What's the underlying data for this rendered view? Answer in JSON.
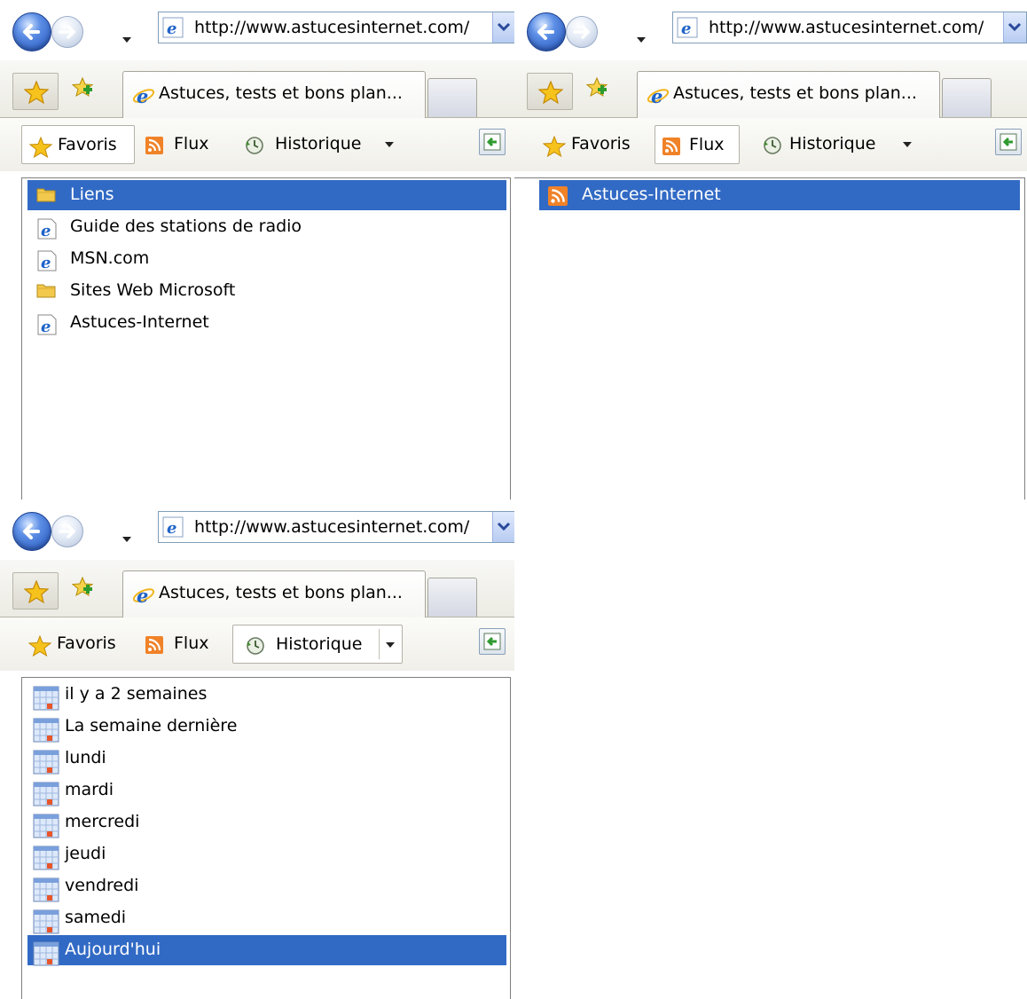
{
  "browser": {
    "address_url": "http://www.astucesinternet.com/",
    "tab_title": "Astuces, tests et bons plan..."
  },
  "center": {
    "favorites_label": "Favoris",
    "feeds_label": "Flux",
    "history_label": "Historique"
  },
  "panels": [
    {
      "active_tab": "Favoris",
      "items": [
        {
          "icon": "folder-icon",
          "label": "Liens",
          "selected": true
        },
        {
          "icon": "ie-page-icon",
          "label": "Guide des stations de radio",
          "selected": false
        },
        {
          "icon": "ie-page-icon",
          "label": "MSN.com",
          "selected": false
        },
        {
          "icon": "folder-icon",
          "label": "Sites Web Microsoft",
          "selected": false
        },
        {
          "icon": "ie-page-icon",
          "label": "Astuces-Internet",
          "selected": false
        }
      ]
    },
    {
      "active_tab": "Flux",
      "items": [
        {
          "icon": "rss-icon",
          "label": "Astuces-Internet",
          "selected": true
        }
      ]
    },
    {
      "active_tab": "Historique",
      "items": [
        {
          "icon": "calendar-icon",
          "label": "il y a 2 semaines",
          "selected": false
        },
        {
          "icon": "calendar-icon",
          "label": "La semaine dernière",
          "selected": false
        },
        {
          "icon": "calendar-icon",
          "label": "lundi",
          "selected": false
        },
        {
          "icon": "calendar-icon",
          "label": "mardi",
          "selected": false
        },
        {
          "icon": "calendar-icon",
          "label": "mercredi",
          "selected": false
        },
        {
          "icon": "calendar-icon",
          "label": "jeudi",
          "selected": false
        },
        {
          "icon": "calendar-icon",
          "label": "vendredi",
          "selected": false
        },
        {
          "icon": "calendar-icon",
          "label": "samedi",
          "selected": false
        },
        {
          "icon": "calendar-icon",
          "label": "Aujourd'hui",
          "selected": true
        }
      ]
    }
  ],
  "colors": {
    "selection": "#316ac5",
    "toolbar_bg": "#ecebe3",
    "ie_blue": "#1f63c8",
    "rss_orange": "#f08228",
    "folder_yellow": "#f2c94c"
  }
}
